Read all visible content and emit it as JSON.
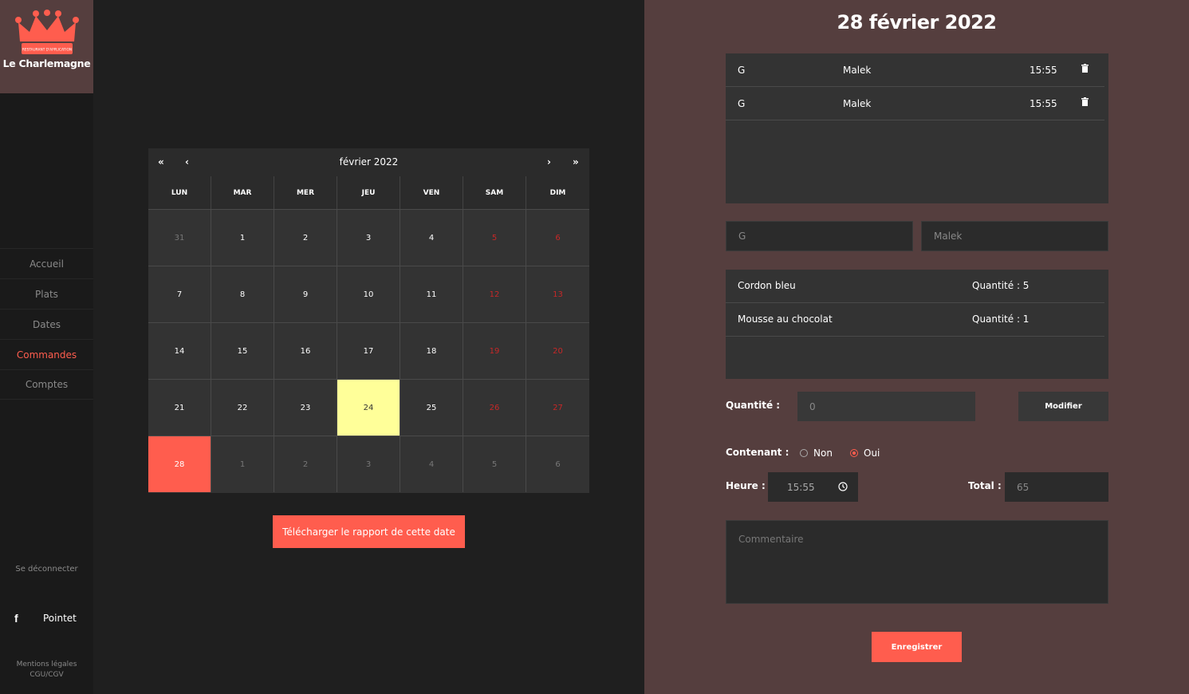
{
  "brand": {
    "name": "Le Charlemagne",
    "banner_text": "RESTAURANT D'APPLICATION",
    "accent": "#ff5d4e",
    "sidebar_bg": "#1a1a1a",
    "panel_bg": "#553e3e"
  },
  "sidebar": {
    "items": [
      {
        "label": "Accueil",
        "active": false
      },
      {
        "label": "Plats",
        "active": false
      },
      {
        "label": "Dates",
        "active": false
      },
      {
        "label": "Commandes",
        "active": true
      },
      {
        "label": "Comptes",
        "active": false
      }
    ],
    "logout_label": "Se déconnecter",
    "social_icon": "facebook-icon",
    "social_label": "Pointet",
    "legal_line1": "Mentions légales",
    "legal_line2": "CGU/CGV"
  },
  "calendar": {
    "prev_year": "«",
    "prev_month": "‹",
    "next_month": "›",
    "next_year": "»",
    "month_label": "février 2022",
    "weekdays": [
      "LUN",
      "MAR",
      "MER",
      "JEU",
      "VEN",
      "SAM",
      "DIM"
    ],
    "days": [
      {
        "d": "31",
        "t": "other"
      },
      {
        "d": "1",
        "t": ""
      },
      {
        "d": "2",
        "t": ""
      },
      {
        "d": "3",
        "t": ""
      },
      {
        "d": "4",
        "t": ""
      },
      {
        "d": "5",
        "t": "weekend"
      },
      {
        "d": "6",
        "t": "weekend"
      },
      {
        "d": "7",
        "t": ""
      },
      {
        "d": "8",
        "t": ""
      },
      {
        "d": "9",
        "t": ""
      },
      {
        "d": "10",
        "t": ""
      },
      {
        "d": "11",
        "t": ""
      },
      {
        "d": "12",
        "t": "weekend"
      },
      {
        "d": "13",
        "t": "weekend"
      },
      {
        "d": "14",
        "t": ""
      },
      {
        "d": "15",
        "t": ""
      },
      {
        "d": "16",
        "t": ""
      },
      {
        "d": "17",
        "t": ""
      },
      {
        "d": "18",
        "t": ""
      },
      {
        "d": "19",
        "t": "weekend"
      },
      {
        "d": "20",
        "t": "weekend"
      },
      {
        "d": "21",
        "t": ""
      },
      {
        "d": "22",
        "t": ""
      },
      {
        "d": "23",
        "t": ""
      },
      {
        "d": "24",
        "t": "today"
      },
      {
        "d": "25",
        "t": ""
      },
      {
        "d": "26",
        "t": "weekend"
      },
      {
        "d": "27",
        "t": "weekend"
      },
      {
        "d": "28",
        "t": "selected"
      },
      {
        "d": "1",
        "t": "other"
      },
      {
        "d": "2",
        "t": "other"
      },
      {
        "d": "3",
        "t": "other"
      },
      {
        "d": "4",
        "t": "other"
      },
      {
        "d": "5",
        "t": "other"
      },
      {
        "d": "6",
        "t": "other"
      }
    ],
    "report_button": "Télécharger le rapport de cette date"
  },
  "detail": {
    "date_title": "28 février 2022",
    "orders": [
      {
        "initial": "G",
        "name": "Malek",
        "time": "15:55"
      },
      {
        "initial": "G",
        "name": "Malek",
        "time": "15:55"
      }
    ],
    "first_name_value": "G",
    "last_name_value": "Malek",
    "items": [
      {
        "dish": "Cordon bleu",
        "qty": "Quantité : 5"
      },
      {
        "dish": "Mousse au chocolat",
        "qty": "Quantité : 1"
      }
    ],
    "quantity_label": "Quantité :",
    "quantity_placeholder": "0",
    "modify_button": "Modifier",
    "container_label": "Contenant :",
    "container_options": [
      {
        "label": "Non",
        "checked": false
      },
      {
        "label": "Oui",
        "checked": true
      }
    ],
    "time_label": "Heure :",
    "time_value": "15:55",
    "total_label": "Total :",
    "total_value": "65",
    "comment_placeholder": "Commentaire",
    "save_button": "Enregistrer"
  }
}
